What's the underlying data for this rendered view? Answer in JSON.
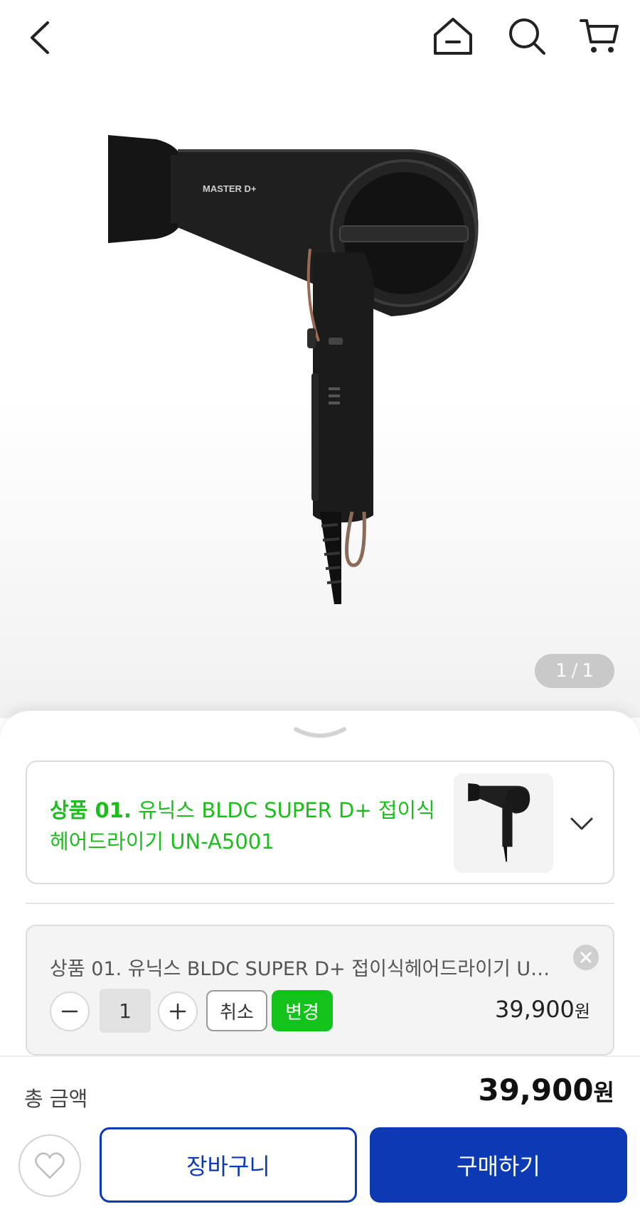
{
  "hero": {
    "image": "hair-dryer",
    "pager": {
      "current": "1",
      "separator": "/",
      "total": "1"
    }
  },
  "product": {
    "number_label": "상품 01.",
    "name": "유닉스 BLDC SUPER D+ 접이식헤어드라이기 UN-A5001",
    "thumb_image": "hair-dryer-thumbnail",
    "accent_color": "#1dbd1d"
  },
  "selected": {
    "name": "상품 01. 유닉스 BLDC SUPER D+  접이식헤어드라이기 UN-A5001",
    "quantity": "1",
    "cancel_label": "취소",
    "change_label": "변경",
    "price": "39,900",
    "currency": "원"
  },
  "total": {
    "label": "총 금액",
    "value": "39,900",
    "currency": "원"
  },
  "actions": {
    "cart_label": "장바구니",
    "buy_label": "구매하기",
    "primary_color": "#0b3ab4"
  },
  "icons": {
    "back": "back-icon",
    "home": "home-icon",
    "search": "search-icon",
    "cart": "cart-icon",
    "heart": "heart-icon"
  }
}
